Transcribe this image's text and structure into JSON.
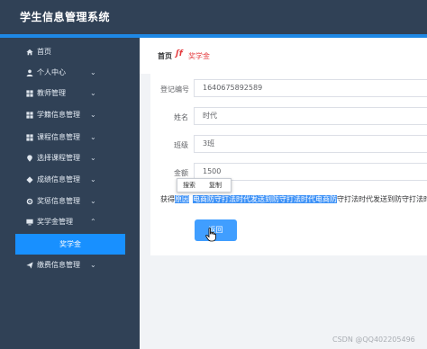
{
  "app": {
    "title": "学生信息管理系统"
  },
  "sidebar": {
    "items": [
      {
        "label": "首页",
        "icon": "home-icon",
        "has_chevron": false
      },
      {
        "label": "个人中心",
        "icon": "user-icon",
        "has_chevron": true
      },
      {
        "label": "教师管理",
        "icon": "grid-icon",
        "has_chevron": true
      },
      {
        "label": "学籍信息管理",
        "icon": "grid-icon",
        "has_chevron": true
      },
      {
        "label": "课程信息管理",
        "icon": "grid-icon",
        "has_chevron": true
      },
      {
        "label": "选择课程管理",
        "icon": "pin-icon",
        "has_chevron": true
      },
      {
        "label": "成绩信息管理",
        "icon": "diamond-icon",
        "has_chevron": true
      },
      {
        "label": "奖惩信息管理",
        "icon": "gear-icon",
        "has_chevron": true
      },
      {
        "label": "奖学金管理",
        "icon": "monitor-icon",
        "has_chevron": true
      },
      {
        "label": "缴费信息管理",
        "icon": "send-icon",
        "has_chevron": true
      }
    ],
    "active_sub": "奖学金"
  },
  "breadcrumb": {
    "home": "首页",
    "separator": "ʃf",
    "current": "奖学金"
  },
  "form": {
    "fields": [
      {
        "label": "登记编号",
        "value": "1640675892589"
      },
      {
        "label": "姓名",
        "value": "时代"
      },
      {
        "label": "班级",
        "value": "3班"
      },
      {
        "label": "金额",
        "value": "1500"
      }
    ],
    "reason_label": "获得",
    "reason_label_highlight": "原因",
    "reason_highlight": "电商防守打法时代发送到防守打法时代电商防",
    "reason_rest": "守打法时代发送到防守打法时代电",
    "back_button": "返回"
  },
  "context_menu": {
    "search": "搜索",
    "copy": "复制"
  },
  "watermark": "CSDN @QQ402205496",
  "colors": {
    "sidebar": "#304156",
    "accent": "#1890ff",
    "button": "#409eff",
    "highlight": "#3e92f7",
    "breadcrumb_current": "#e4393c"
  }
}
